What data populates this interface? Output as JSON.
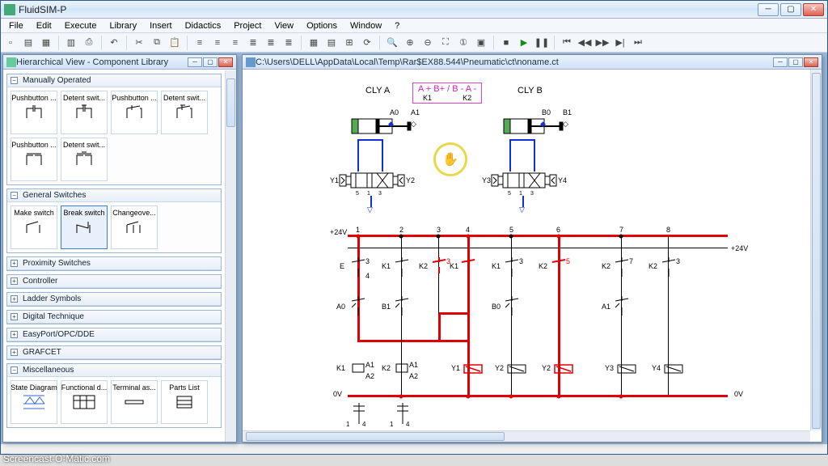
{
  "app_title": "FluidSIM-P",
  "menubar": [
    "File",
    "Edit",
    "Execute",
    "Library",
    "Insert",
    "Didactics",
    "Project",
    "View",
    "Options",
    "Window",
    "?"
  ],
  "toolbar_groups": [
    [
      "new",
      "open",
      "save"
    ],
    [
      "print-preview",
      "print"
    ],
    [
      "undo"
    ],
    [
      "cut",
      "copy",
      "paste"
    ],
    [
      "align-left",
      "align-center",
      "align-right",
      "align-top",
      "align-middle",
      "align-bottom"
    ],
    [
      "grid",
      "rulers",
      "snap",
      "refresh"
    ],
    [
      "zoom-tool",
      "zoom-in",
      "zoom-out",
      "zoom-fit",
      "zoom-actual",
      "zoom-selection"
    ],
    [
      "stop",
      "play",
      "pause"
    ],
    [
      "step-back",
      "rewind",
      "forward",
      "step-fwd",
      "step-end"
    ]
  ],
  "left_panel": {
    "title": "Hierarchical View - Component Library",
    "categories": [
      {
        "name": "Manually Operated",
        "open": true,
        "items": [
          "Pushbutton ...",
          "Detent swit...",
          "Pushbutton ...",
          "Detent swit...",
          "Pushbutton ...",
          "Detent swit..."
        ]
      },
      {
        "name": "General Switches",
        "open": true,
        "items": [
          "Make switch",
          "Break switch",
          "Changeove..."
        ]
      },
      {
        "name": "Proximity Switches",
        "open": false
      },
      {
        "name": "Controller",
        "open": false
      },
      {
        "name": "Ladder Symbols",
        "open": false
      },
      {
        "name": "Digital Technique",
        "open": false
      },
      {
        "name": "EasyPort/OPC/DDE",
        "open": false
      },
      {
        "name": "GRAFCET",
        "open": false
      },
      {
        "name": "Miscellaneous",
        "open": true,
        "items": [
          "State Diagram",
          "Functional d...",
          "Terminal as...",
          "Parts List"
        ]
      }
    ]
  },
  "circuit_window": {
    "title": "C:\\Users\\DELL\\AppData\\Local\\Temp\\Rar$EX88.544\\Pneumatic\\ct\\noname.ct",
    "labels": {
      "cly_a": "CLY  A",
      "cly_b": "CLY  B",
      "formula": "A + B+ / B - A -",
      "k1": "K1",
      "k2": "K2",
      "a0": "A0",
      "a1": "A1",
      "b0": "B0",
      "b1": "B1",
      "y1": "Y1",
      "y2": "Y2",
      "y3": "Y3",
      "y4": "Y4",
      "p24v": "+24V",
      "n0v": "0V",
      "rungs": [
        "1",
        "2",
        "3",
        "4",
        "5",
        "6",
        "7",
        "8"
      ]
    },
    "ladder_labels": {
      "e": "E",
      "k1": "K1",
      "k2": "K2",
      "a0": "A0",
      "a1": "A1",
      "a2": "A2",
      "b0": "B0",
      "b1": "B1",
      "three": "3",
      "four": "4",
      "five": "5",
      "seven": "7",
      "one": "1",
      "fourb": "4"
    }
  },
  "watermark": "Screencast-O-Matic.com"
}
